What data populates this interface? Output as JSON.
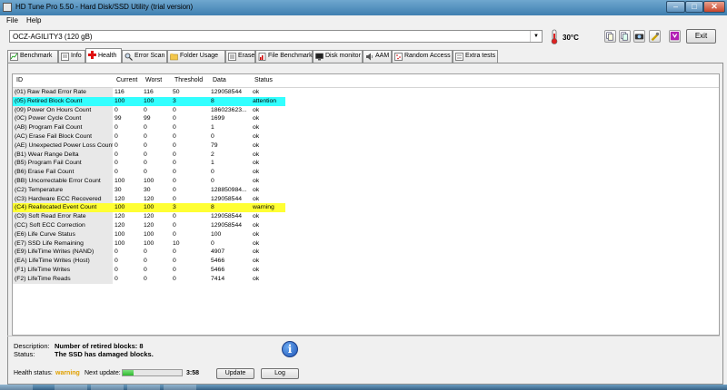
{
  "window": {
    "title": "HD Tune Pro 5.50 - Hard Disk/SSD Utility (trial version)",
    "minimize_icon": "minimize-icon",
    "maximize_icon": "maximize-icon",
    "close_icon": "close-icon"
  },
  "menu": {
    "items": [
      {
        "label": "File",
        "icon": "none"
      },
      {
        "label": "Help",
        "icon": "none"
      }
    ]
  },
  "toolbar": {
    "drive": "OCZ-AGILITY3 (120 gB)",
    "temperature": "30°C",
    "exit_label": "Exit",
    "icons": [
      "copy-text-icon",
      "copy-info-icon",
      "screenshot-icon",
      "options-icon",
      "save-icon"
    ]
  },
  "tabs": [
    {
      "label": "Benchmark",
      "icon": "benchmark-icon"
    },
    {
      "label": "Info",
      "icon": "info-icon"
    },
    {
      "label": "Health",
      "icon": "health-cross-icon",
      "active": true
    },
    {
      "label": "Error Scan",
      "icon": "magnifier-icon"
    },
    {
      "label": "Folder Usage",
      "icon": "folder-icon"
    },
    {
      "label": "Erase",
      "icon": "erase-icon"
    },
    {
      "label": "File Benchmark",
      "icon": "file-benchmark-icon"
    },
    {
      "label": "Disk monitor",
      "icon": "monitor-icon"
    },
    {
      "label": "AAM",
      "icon": "speaker-icon"
    },
    {
      "label": "Random Access",
      "icon": "random-access-icon"
    },
    {
      "label": "Extra tests",
      "icon": "extra-tests-icon"
    }
  ],
  "health_table": {
    "columns": [
      "ID",
      "Current",
      "Worst",
      "Threshold",
      "Data",
      "Status"
    ],
    "rows": [
      {
        "id": "(01) Raw Read Error Rate",
        "current": "116",
        "worst": "116",
        "threshold": "50",
        "data": "129058544",
        "status": "ok"
      },
      {
        "id": "(05) Retired Block Count",
        "current": "100",
        "worst": "100",
        "threshold": "3",
        "data": "8",
        "status": "attention",
        "highlight": "#33ffff"
      },
      {
        "id": "(09) Power On Hours Count",
        "current": "0",
        "worst": "0",
        "threshold": "0",
        "data": "186023623...",
        "status": "ok"
      },
      {
        "id": "(0C) Power Cycle Count",
        "current": "99",
        "worst": "99",
        "threshold": "0",
        "data": "1699",
        "status": "ok"
      },
      {
        "id": "(AB) Program Fail Count",
        "current": "0",
        "worst": "0",
        "threshold": "0",
        "data": "1",
        "status": "ok"
      },
      {
        "id": "(AC) Erase Fail Block Count",
        "current": "0",
        "worst": "0",
        "threshold": "0",
        "data": "0",
        "status": "ok"
      },
      {
        "id": "(AE) Unexpected Power Loss Count",
        "current": "0",
        "worst": "0",
        "threshold": "0",
        "data": "79",
        "status": "ok"
      },
      {
        "id": "(B1) Wear Range Delta",
        "current": "0",
        "worst": "0",
        "threshold": "0",
        "data": "2",
        "status": "ok"
      },
      {
        "id": "(B5) Program Fail Count",
        "current": "0",
        "worst": "0",
        "threshold": "0",
        "data": "1",
        "status": "ok"
      },
      {
        "id": "(B6) Erase Fail Count",
        "current": "0",
        "worst": "0",
        "threshold": "0",
        "data": "0",
        "status": "ok"
      },
      {
        "id": "(BB) Uncorrectable Error Count",
        "current": "100",
        "worst": "100",
        "threshold": "0",
        "data": "0",
        "status": "ok"
      },
      {
        "id": "(C2) Temperature",
        "current": "30",
        "worst": "30",
        "threshold": "0",
        "data": "128850984...",
        "status": "ok"
      },
      {
        "id": "(C3) Hardware ECC Recovered",
        "current": "120",
        "worst": "120",
        "threshold": "0",
        "data": "129058544",
        "status": "ok"
      },
      {
        "id": "(C4) Reallocated Event Count",
        "current": "100",
        "worst": "100",
        "threshold": "3",
        "data": "8",
        "status": "warning",
        "highlight": "#ffff33"
      },
      {
        "id": "(C9) Soft Read Error Rate",
        "current": "120",
        "worst": "120",
        "threshold": "0",
        "data": "129058544",
        "status": "ok"
      },
      {
        "id": "(CC) Soft ECC Correction",
        "current": "120",
        "worst": "120",
        "threshold": "0",
        "data": "129058544",
        "status": "ok"
      },
      {
        "id": "(E6) Life Curve Status",
        "current": "100",
        "worst": "100",
        "threshold": "0",
        "data": "100",
        "status": "ok"
      },
      {
        "id": "(E7) SSD Life Remaining",
        "current": "100",
        "worst": "100",
        "threshold": "10",
        "data": "0",
        "status": "ok"
      },
      {
        "id": "(E9) LifeTime Writes (NAND)",
        "current": "0",
        "worst": "0",
        "threshold": "0",
        "data": "4907",
        "status": "ok"
      },
      {
        "id": "(EA) LifeTime Writes (Host)",
        "current": "0",
        "worst": "0",
        "threshold": "0",
        "data": "5466",
        "status": "ok"
      },
      {
        "id": "(F1) LifeTime Writes",
        "current": "0",
        "worst": "0",
        "threshold": "0",
        "data": "5466",
        "status": "ok"
      },
      {
        "id": "(F2) LifeTime Reads",
        "current": "0",
        "worst": "0",
        "threshold": "0",
        "data": "7414",
        "status": "ok"
      }
    ]
  },
  "details": {
    "description_label": "Description:",
    "description_value": "Number of retired blocks: 8",
    "status_label": "Status:",
    "status_value": "The SSD has damaged blocks.",
    "info_icon": "info-circle-icon"
  },
  "footer": {
    "health_status_label": "Health status:",
    "health_status_value": "warning",
    "health_status_color": "#e0a000",
    "next_update_label": "Next update:",
    "next_update_progress": 0.18,
    "next_update_time": "3:58",
    "update_label": "Update",
    "log_label": "Log"
  }
}
